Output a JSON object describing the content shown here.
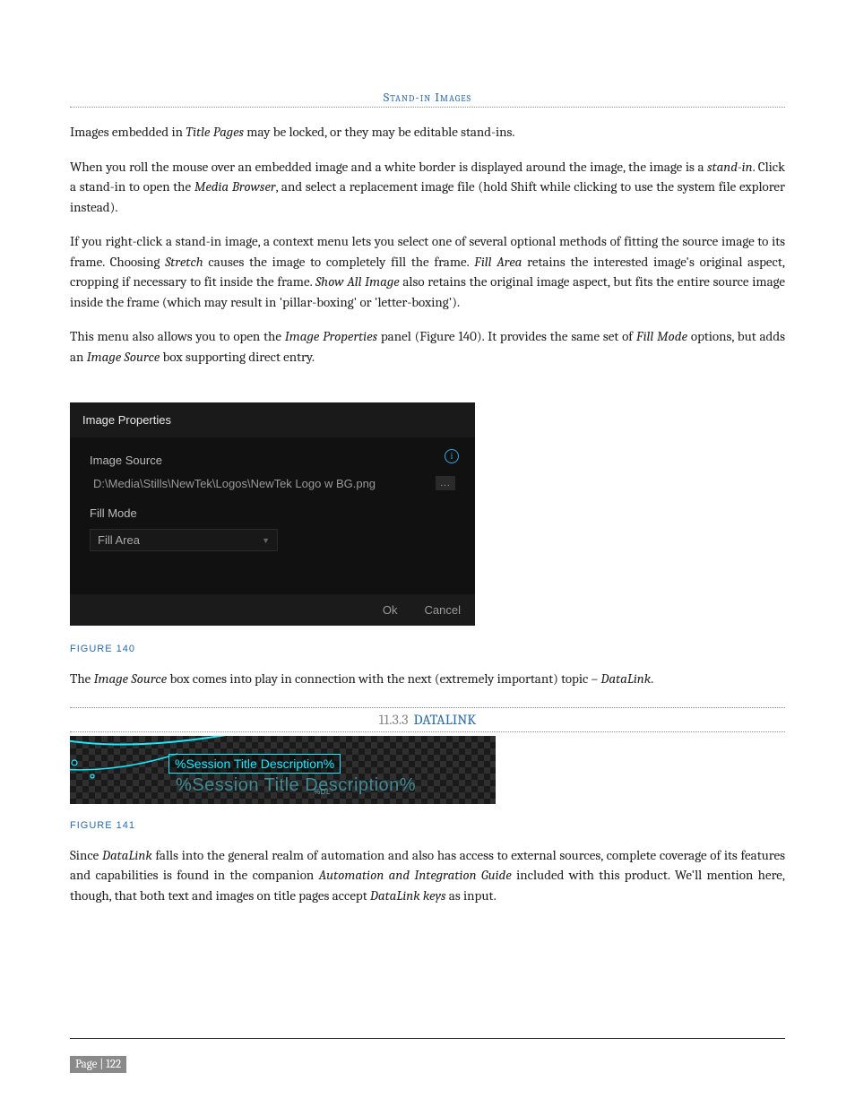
{
  "section_header": "Stand-in Images",
  "p1a": "Images embedded in ",
  "p1i": "Title Pages",
  "p1b": " may be locked, or they may be editable stand-ins.",
  "p2a": "When you roll the mouse over an embedded image and a white border is displayed around the image, the image is a ",
  "p2i": "stand-in",
  "p2b": ".  Click a stand-in to open the ",
  "p2i2": "Media Browser",
  "p2c": ", and select a replacement image file (hold Shift while clicking to use the system file explorer instead).",
  "p3a": "If you right-click a stand-in image, a context menu lets you select one of several optional methods of fitting the source image to its frame.  Choosing ",
  "p3i1": "Stretch",
  "p3b": " causes the image to completely fill the frame.  ",
  "p3i2": "Fill Area",
  "p3c": " retains the interested image's original aspect, cropping if necessary to fit inside the frame.  ",
  "p3i3": "Show All Image",
  "p3d": " also retains the original image aspect, but fits the entire source image inside the frame (which may result in 'pillar-boxing' or 'letter-boxing').",
  "p4a": "This menu also allows you to open the ",
  "p4i1": "Image Properties",
  "p4b": " panel (Figure 140).  It provides the same set of ",
  "p4i2": "Fill Mode",
  "p4c": " options, but adds an ",
  "p4i3": "Image Source",
  "p4d": "  box supporting direct entry.",
  "dialog": {
    "title": "Image Properties",
    "image_source_label": "Image Source",
    "image_source_value": "D:\\Media\\Stills\\NewTek\\Logos\\NewTek Logo w BG.png",
    "browse_glyph": "...",
    "fill_mode_label": "Fill Mode",
    "fill_mode_value": "Fill Area",
    "ok": "Ok",
    "cancel": "Cancel",
    "info_glyph": "i"
  },
  "figure140": "FIGURE 140",
  "p5a": "The ",
  "p5i1": "Image Source",
  "p5b": " box comes into play in connection with the next (extremely important) topic – ",
  "p5i2": "DataLink",
  "p5c": ".",
  "datalink_num": "11.3.3",
  "datalink_title": "DATALINK",
  "dl_fig": {
    "box_text": "%Session Title Description%",
    "shadow_text": "%Session Title Description%",
    "dl_tag": "%DL"
  },
  "figure141": "FIGURE 141",
  "p6a": "Since ",
  "p6i1": "DataLink",
  "p6b": " falls into the general realm of automation and also has access to external sources, complete coverage of its features and capabilities is found in the companion ",
  "p6i2": "Automation and Integration Guide",
  "p6c": " included with this product.  We'll mention here, though, that both text and images on title pages accept ",
  "p6i3": "DataLink keys",
  "p6d": " as input.",
  "page_footer": "Page | 122"
}
